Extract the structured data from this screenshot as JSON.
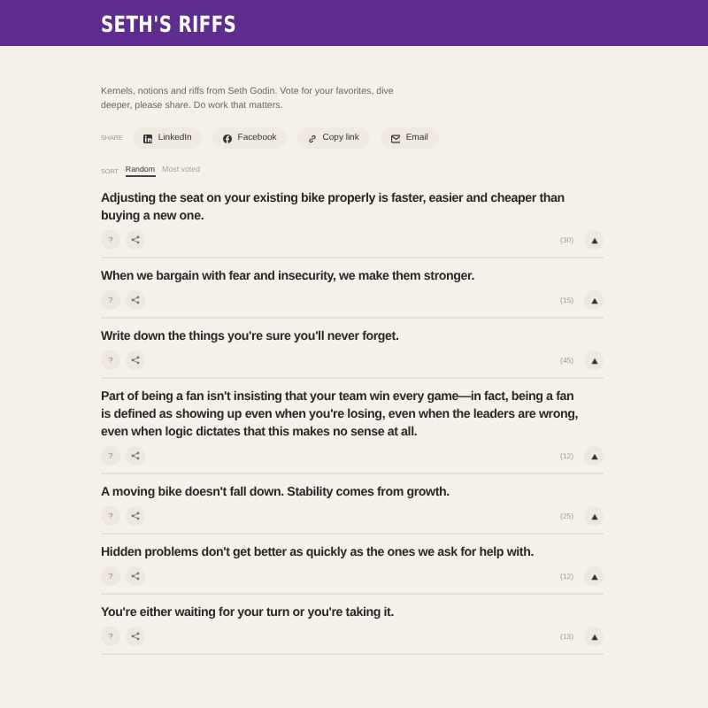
{
  "header": {
    "title": "SETH'S RIFFS"
  },
  "intro": "Kernels, notions and riffs from Seth Godin. Vote for your favorites, dive deeper, please share. Do work that matters.",
  "share": {
    "label": "SHARE",
    "buttons": [
      {
        "kind": "linkedin",
        "label": "LinkedIn"
      },
      {
        "kind": "facebook",
        "label": "Facebook"
      },
      {
        "kind": "link",
        "label": "Copy link"
      },
      {
        "kind": "email",
        "label": "Email"
      }
    ]
  },
  "sort": {
    "label": "SORT",
    "tabs": [
      {
        "label": "Random",
        "selected": true
      },
      {
        "label": "Most voted",
        "selected": false
      }
    ]
  },
  "riffs": [
    {
      "text": "Adjusting the seat on your existing bike properly is faster, easier and cheaper than buying a new one.",
      "more": "?",
      "votes": "(30)"
    },
    {
      "text": "When we bargain with fear and insecurity, we make them stronger.",
      "more": "?",
      "votes": "(15)"
    },
    {
      "text": "Write down the things you're sure you'll never forget.",
      "more": "?",
      "votes": "(45)"
    },
    {
      "text": "Part of being a fan isn't insisting that your team win every game—in fact, being a fan is defined as showing up even when you're losing, even when the leaders are wrong, even when logic dictates that this makes no sense at all.",
      "more": "?",
      "votes": "(12)"
    },
    {
      "text": "A moving bike doesn't fall down. Stability comes from growth.",
      "more": "?",
      "votes": "(25)"
    },
    {
      "text": "Hidden problems don't get better as quickly as the ones we ask for help with.",
      "more": "?",
      "votes": "(12)"
    },
    {
      "text": "You're either waiting for your turn or you're taking it.",
      "more": "?",
      "votes": "(13)"
    }
  ]
}
